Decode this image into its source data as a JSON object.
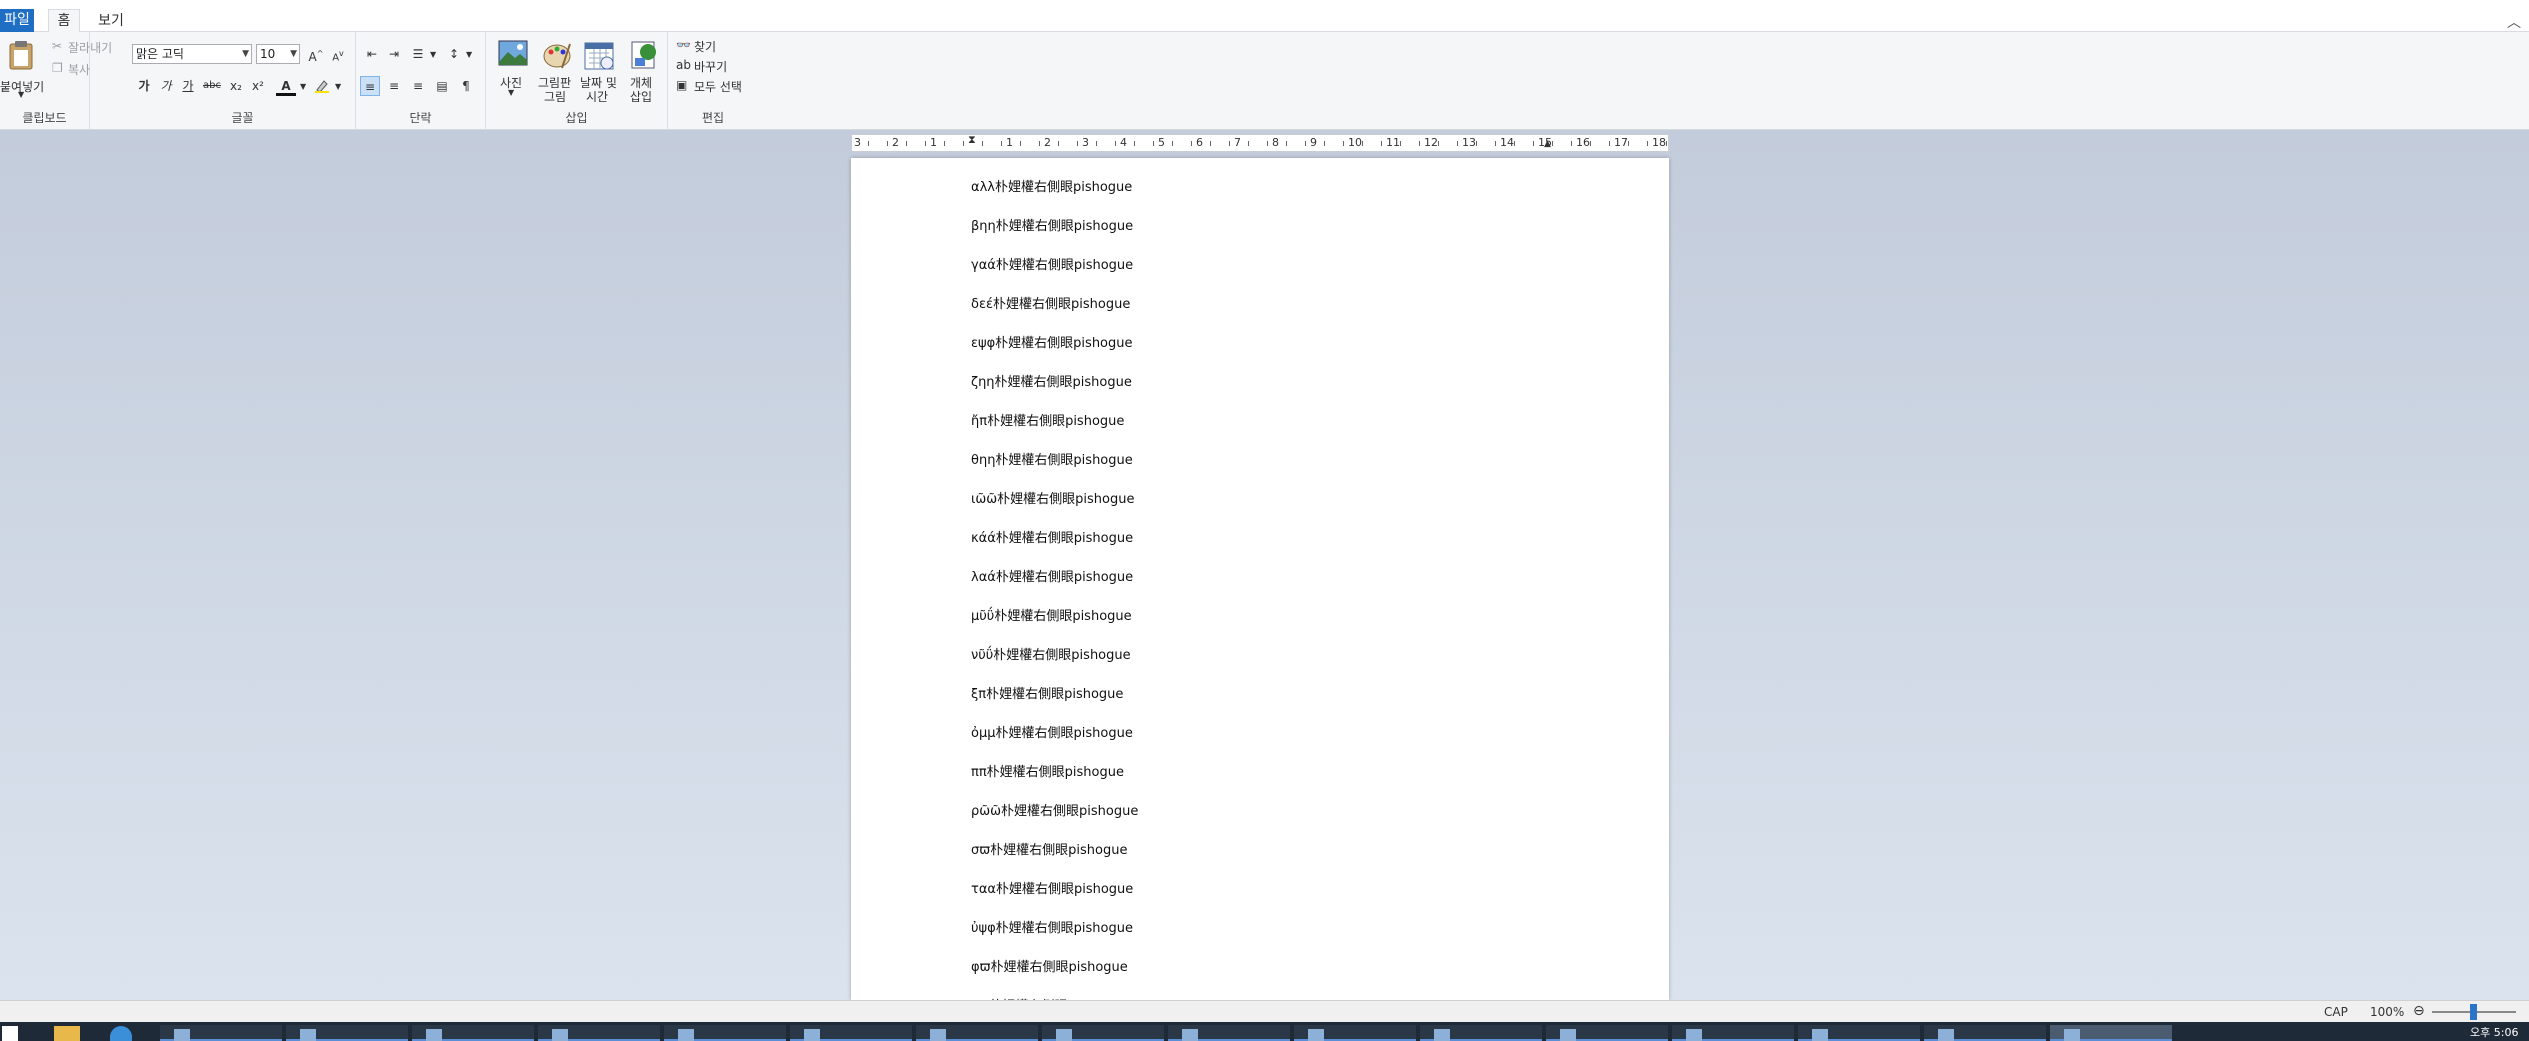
{
  "tabs": {
    "file": "파일",
    "home": "홈",
    "view": "보기"
  },
  "clipboard": {
    "paste": "붙여넣기",
    "cut": "잘라내기",
    "copy": "복사",
    "label": "클립보드"
  },
  "font": {
    "name": "맑은 고딕",
    "size": "10",
    "label": "글꼴",
    "bold": "가",
    "italic": "가",
    "underline": "가",
    "strike": "abc",
    "subscript": "x₂",
    "superscript": "x²",
    "color_letter": "A"
  },
  "paragraph": {
    "label": "단락"
  },
  "insert": {
    "picture": "사진",
    "paint1": "그림판",
    "paint2": "그림",
    "datetime1": "날짜 및",
    "datetime2": "시간",
    "object1": "개체",
    "object2": "삽입",
    "label": "삽입"
  },
  "editing": {
    "find": "찾기",
    "replace": "바꾸기",
    "select_all": "모두 선택",
    "label": "편집"
  },
  "ruler": {
    "labels": [
      "3",
      "2",
      "1",
      "1",
      "2",
      "3",
      "4",
      "5",
      "6",
      "7",
      "8",
      "9",
      "10",
      "11",
      "12",
      "13",
      "14",
      "15",
      "16",
      "17",
      "18"
    ]
  },
  "document": {
    "lines": [
      "αλλ朴娌權右側眼pishogue",
      "βηη朴娌權右側眼pishogue",
      "γαά朴娌權右側眼pishogue",
      "δεέ朴娌權右側眼pishogue",
      "εψφ朴娌權右側眼pishogue",
      "ζηη朴娌權右側眼pishogue",
      "ἤπ朴娌權右側眼pishogue",
      "θηη朴娌權右側眼pishogue",
      "ιῶῶ朴娌權右側眼pishogue",
      "κάά朴娌權右側眼pishogue",
      "λαά朴娌權右側眼pishogue",
      "μῦΰ朴娌權右側眼pishogue",
      "νῦΰ朴娌權右側眼pishogue",
      "ξπ朴娌權右側眼pishogue",
      "ὀμμ朴娌權右側眼pishogue",
      "ππ朴娌權右側眼pishogue",
      "ρῶῶ朴娌權右側眼pishogue",
      "σϖ朴娌權右側眼pishogue",
      "ταα朴娌權右側眼pishogue",
      "ὐψφ朴娌權右側眼pishogue",
      "φϖ朴娌權右側眼pishogue",
      "χϖ朴娌權右側眼pishogue"
    ]
  },
  "status": {
    "caps": "CAP",
    "zoom": "100%",
    "zoom_out": "⊖"
  },
  "taskbar": {
    "time": "오후 5:06"
  }
}
